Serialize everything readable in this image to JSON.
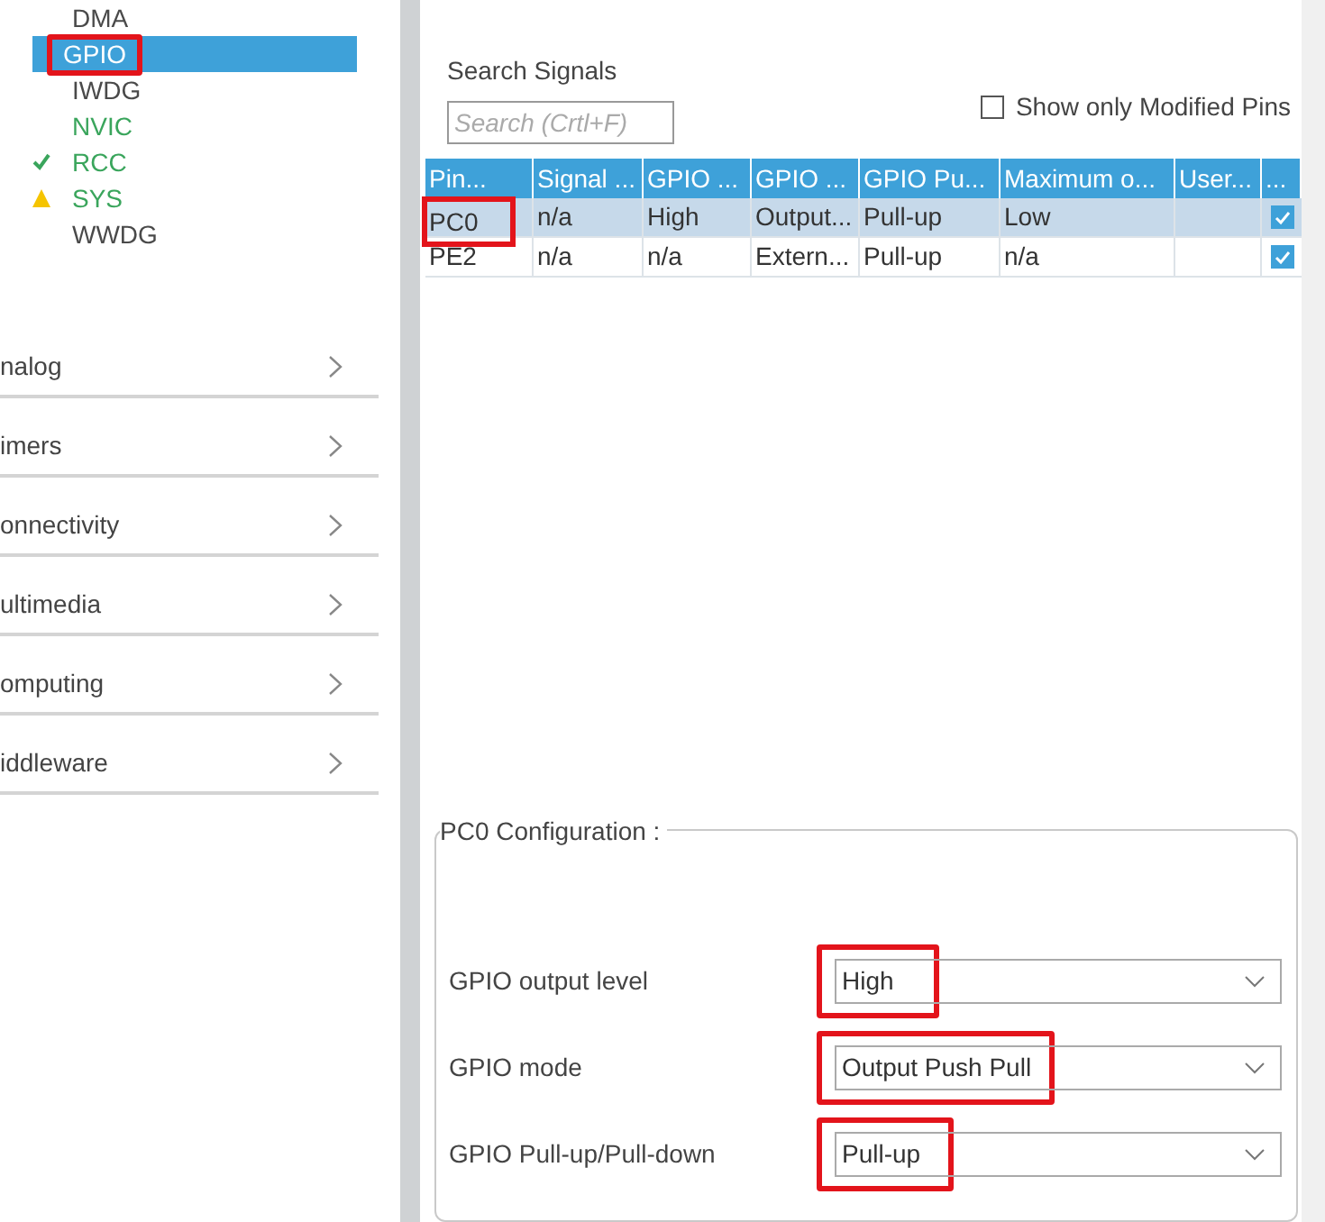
{
  "sidebar": {
    "items": [
      {
        "label": "DMA",
        "kind": "plain",
        "selected": false,
        "highlighted": false
      },
      {
        "label": "GPIO",
        "kind": "plain",
        "selected": true,
        "highlighted": true
      },
      {
        "label": "IWDG",
        "kind": "plain",
        "selected": false,
        "highlighted": false
      },
      {
        "label": "NVIC",
        "kind": "enabled",
        "selected": false,
        "highlighted": false
      },
      {
        "label": "RCC",
        "kind": "ok",
        "selected": false,
        "highlighted": false
      },
      {
        "label": "SYS",
        "kind": "warning",
        "selected": false,
        "highlighted": false
      },
      {
        "label": "WWDG",
        "kind": "plain",
        "selected": false,
        "highlighted": false
      }
    ],
    "categories": [
      "nalog",
      "imers",
      "onnectivity",
      "ultimedia",
      "omputing",
      "iddleware"
    ]
  },
  "search": {
    "label": "Search Signals",
    "placeholder": "Search (Crtl+F)"
  },
  "modified_filter": {
    "label": "Show only Modified Pins",
    "checked": false
  },
  "table": {
    "columns": [
      "Pin...",
      "Signal ...",
      "GPIO ...",
      "GPIO ...",
      "GPIO Pu...",
      "Maximum o...",
      "User...",
      "..."
    ],
    "rows": [
      {
        "cells": [
          "PC0",
          "n/a",
          "High",
          "Output...",
          "Pull-up",
          "Low",
          ""
        ],
        "checked": true,
        "selected": true,
        "highlighted": true
      },
      {
        "cells": [
          "PE2",
          "n/a",
          "n/a",
          "Extern...",
          "Pull-up",
          "n/a",
          ""
        ],
        "checked": true,
        "selected": false,
        "highlighted": false
      }
    ]
  },
  "config": {
    "title": "PC0 Configuration :",
    "fields": [
      {
        "label": "GPIO output level",
        "value": "High",
        "highlighted": true
      },
      {
        "label": "GPIO mode",
        "value": "Output Push Pull",
        "highlighted": true
      },
      {
        "label": "GPIO Pull-up/Pull-down",
        "value": "Pull-up",
        "highlighted": true
      }
    ]
  }
}
